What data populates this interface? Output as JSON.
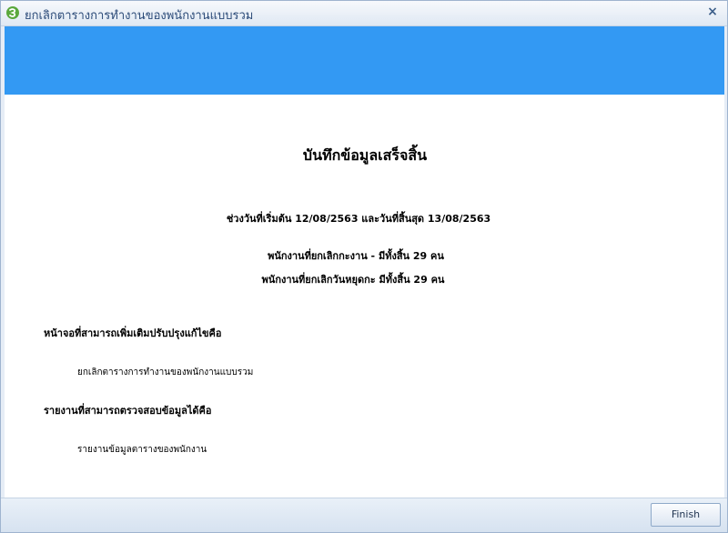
{
  "window": {
    "title": "ยกเลิกตารางการทำงานของพนักงานแบบรวม",
    "close_label": "×"
  },
  "colors": {
    "banner": "#3399f3",
    "title_text": "#2b4a78"
  },
  "icons": {
    "app": "app-logo-icon",
    "close": "close-icon"
  },
  "content": {
    "heading": "บันทึกข้อมูลเสร็จสิ้น",
    "date_range": "ช่วงวันที่เริ่มต้น 12/08/2563 และวันที่สิ้นสุด 13/08/2563",
    "cancel_work": "พนักงานที่ยกเลิกกะงาน -  มีทั้งสิ้น 29 คน",
    "cancel_holiday": "พนักงานที่ยกเลิกวันหยุดกะ มีทั้งสิ้น 29 คน",
    "editable_screens_label": "หน้าจอที่สามารถเพิ่มเติมปรับปรุงแก้ไขคือ",
    "editable_screens": [
      "ยกเลิกตารางการทำงานของพนักงานแบบรวม"
    ],
    "reports_label": "รายงานที่สามารถตรวจสอบข้อมูลได้คือ",
    "reports": [
      "รายงานข้อมูลตารางของพนักงาน"
    ]
  },
  "footer": {
    "finish_label": "Finish"
  }
}
